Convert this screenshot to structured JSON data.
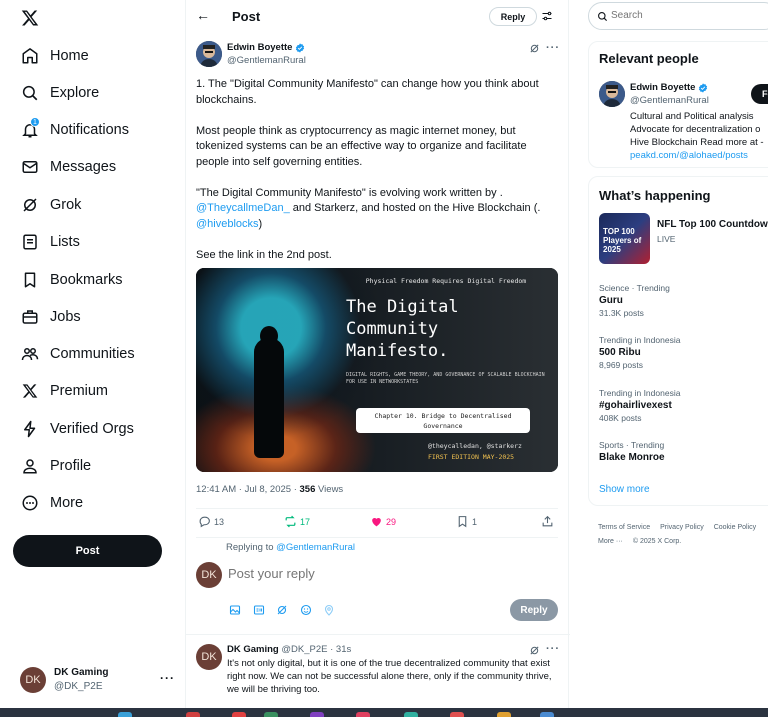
{
  "nav": {
    "items": [
      {
        "label": "Home",
        "icon": "home-icon"
      },
      {
        "label": "Explore",
        "icon": "search-icon"
      },
      {
        "label": "Notifications",
        "icon": "bell-icon",
        "badge": "1"
      },
      {
        "label": "Messages",
        "icon": "mail-icon"
      },
      {
        "label": "Grok",
        "icon": "grok-icon"
      },
      {
        "label": "Lists",
        "icon": "list-icon"
      },
      {
        "label": "Bookmarks",
        "icon": "bookmark-icon"
      },
      {
        "label": "Jobs",
        "icon": "briefcase-icon"
      },
      {
        "label": "Communities",
        "icon": "people-icon"
      },
      {
        "label": "Premium",
        "icon": "x-logo-icon"
      },
      {
        "label": "Verified Orgs",
        "icon": "lightning-icon"
      },
      {
        "label": "Profile",
        "icon": "person-icon"
      },
      {
        "label": "More",
        "icon": "more-circle-icon"
      }
    ],
    "post_button": "Post",
    "account": {
      "name": "DK Gaming",
      "handle": "@DK_P2E",
      "initials": "DK"
    }
  },
  "header": {
    "title": "Post",
    "reply_label": "Reply"
  },
  "tweet": {
    "author_name": "Edwin Boyette",
    "author_handle": "@GentlemanRural",
    "p1": "1. The \"Digital Community Manifesto\" can change how you think about blockchains.",
    "p2": "Most people think as cryptocurrency as magic internet money, but tokenized systems can be an effective way to organize and facilitate people into self governing entities.",
    "p3_a": "\"The Digital Community Manifesto\" is evolving work written by .",
    "p3_link1": "@TheycallmeDan_",
    "p3_b": " and Starkerz, and hosted on the Hive Blockchain (.",
    "p3_link2": "@hiveblocks",
    "p3_c": ")",
    "p4": "See the link in the 2nd post.",
    "image": {
      "top_line": "Physical Freedom Requires Digital Freedom",
      "title_1": "The Digital",
      "title_2": "Community",
      "title_3": "Manifesto.",
      "subtitle": "DIGITAL RIGHTS, GAME THEORY, AND GOVERNANCE OF SCALABLE BLOCKCHAIN FOR USE IN NETWORKSTATES",
      "box_1": "Chapter 10. Bridge to Decentralised",
      "box_2": "Governance",
      "authors": "@theycalledan, @starkerz",
      "edition": "FIRST EDITION MAY-2025"
    },
    "time": "12:41 AM · Jul 8, 2025 · ",
    "views_count": "356",
    "views_label": " Views",
    "replies": "13",
    "reposts": "17",
    "likes": "29",
    "bookmarks": "1"
  },
  "composer": {
    "replying_to_prefix": "Replying to ",
    "replying_to_handle": "@GentlemanRural",
    "placeholder": "Post your reply",
    "reply_button": "Reply",
    "avatar_initials": "DK"
  },
  "reply": {
    "name": "DK Gaming",
    "handle": "@DK_P2E",
    "time": " · 31s",
    "initials": "DK",
    "text": "It's not only digital, but it is one of the true decentralized community that exist right now. We can not be successful alone there, only if the community thrive, we will be thriving too."
  },
  "sidebar": {
    "search_placeholder": "Search",
    "relevant_title": "Relevant people",
    "person": {
      "name": "Edwin Boyette",
      "handle": "@GentlemanRural",
      "follow_label": "Fo",
      "bio_1": "Cultural and Political analysis",
      "bio_2": "Advocate for decentralization o",
      "bio_3": "Hive Blockchain Read more at -",
      "bio_link": "peakd.com/@alohaed/posts"
    },
    "happening_title": "What’s happening",
    "nfl": {
      "title": "NFL Top 100 Countdown",
      "status": "LIVE",
      "thumb_text": "TOP 100 Players of 2025"
    },
    "trends": [
      {
        "category": "Science · Trending",
        "title": "Guru",
        "count": "31.3K posts"
      },
      {
        "category": "Trending in Indonesia",
        "title": "500 Ribu",
        "count": "8,969 posts"
      },
      {
        "category": "Trending in Indonesia",
        "title": "#gohairlivexest",
        "count": "408K posts"
      },
      {
        "category": "Sports · Trending",
        "title": "Blake Monroe",
        "count": ""
      }
    ],
    "show_more": "Show more",
    "footer": {
      "terms": "Terms of Service",
      "privacy": "Privacy Policy",
      "cookie": "Cookie Policy",
      "more": "More ···",
      "copyright": "© 2025 X Corp."
    }
  },
  "colors": {
    "accent": "#1d9bf0",
    "like": "#f91880",
    "repost": "#00ba7c",
    "text": "#0f1419",
    "muted": "#536471"
  }
}
